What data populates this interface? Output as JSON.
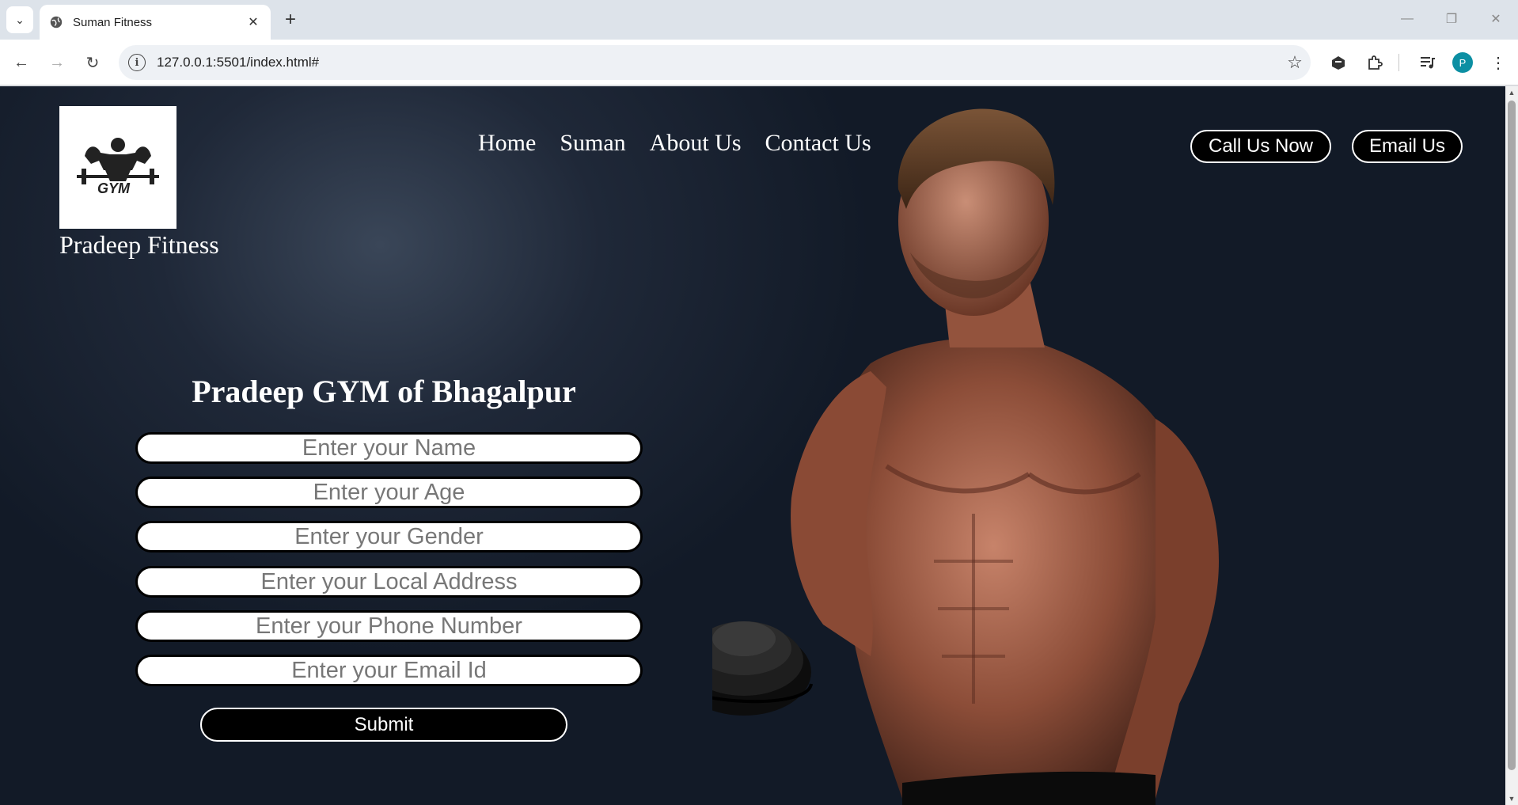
{
  "browser": {
    "tab_title": "Suman Fitness",
    "url": "127.0.0.1:5501/index.html#",
    "profile_initial": "P"
  },
  "site": {
    "logo_text": "GYM",
    "brand_name": "Pradeep Fitness",
    "nav": [
      "Home",
      "Suman",
      "About Us",
      "Contact Us"
    ],
    "call_button": "Call Us Now",
    "email_button": "Email Us"
  },
  "form": {
    "title": "Pradeep GYM of Bhagalpur",
    "fields": [
      {
        "placeholder": "Enter your Name"
      },
      {
        "placeholder": "Enter your Age"
      },
      {
        "placeholder": "Enter your Gender"
      },
      {
        "placeholder": "Enter your Local Address"
      },
      {
        "placeholder": "Enter your Phone Number"
      },
      {
        "placeholder": "Enter your Email Id"
      }
    ],
    "submit": "Submit"
  },
  "colors": {
    "accent": "#0c8fa3",
    "page_bg": "#121a27"
  }
}
